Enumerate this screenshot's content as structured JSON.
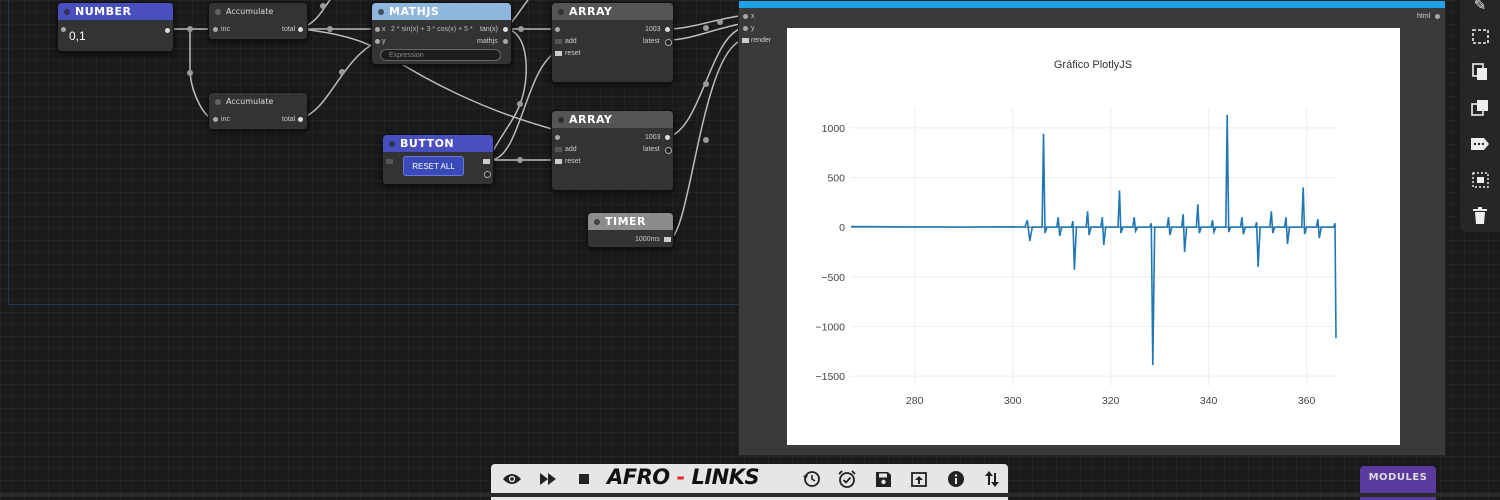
{
  "nodes": {
    "number": {
      "title": "NUMBER",
      "value": "0,1"
    },
    "accumulate1": {
      "title": "Accumulate",
      "in_label": "inc",
      "out_label": "total"
    },
    "accumulate2": {
      "title": "Accumulate",
      "in_label": "inc",
      "out_label": "total"
    },
    "mathjs": {
      "title": "MATHJS",
      "in_x": "x",
      "in_y": "y",
      "formula": "2 * sin(x) + 3 * cos(x) + 5 *",
      "out1": "tan(x)",
      "out2": "mathjs",
      "expr_placeholder": "Expression"
    },
    "array1": {
      "title": "ARRAY",
      "count": "1003",
      "add": "add",
      "reset": "reset",
      "latest": "latest"
    },
    "array2": {
      "title": "ARRAY",
      "count": "1003",
      "add": "add",
      "reset": "reset",
      "latest": "latest"
    },
    "button": {
      "title": "BUTTON",
      "label": "RESET ALL"
    },
    "timer": {
      "title": "TIMER",
      "interval": "1000ms"
    },
    "plotly": {
      "in_x": "x",
      "in_y": "y",
      "in_render": "render",
      "out": "html"
    }
  },
  "chart_data": {
    "type": "line",
    "title": "Gráfico PlotlyJS",
    "xlabel": "",
    "ylabel": "",
    "xlim": [
      267,
      366
    ],
    "ylim": [
      -1600,
      1200
    ],
    "xticks": [
      "280",
      "300",
      "320",
      "340",
      "360"
    ],
    "xtick_values": [
      280,
      300,
      320,
      340,
      360
    ],
    "yticks": [
      "1000",
      "500",
      "0",
      "−500",
      "−1000",
      "−1500"
    ],
    "ytick_values": [
      1000,
      500,
      0,
      -500,
      -1000,
      -1500
    ],
    "grid": true,
    "color": "#1f77b4",
    "series": [
      {
        "x": [
          267,
          280,
          290,
          300,
          302.5,
          303,
          303.5,
          304,
          306,
          306.3,
          306.6,
          307,
          309,
          309.3,
          309.6,
          310,
          312,
          312.3,
          312.6,
          313,
          315,
          315.3,
          315.6,
          316,
          318,
          318.3,
          318.6,
          319,
          321.5,
          321.8,
          322.1,
          322.5,
          324.5,
          324.8,
          325.1,
          325.5,
          328,
          328.3,
          328.6,
          329,
          331.5,
          331.8,
          332.1,
          332.5,
          334.5,
          334.8,
          335.1,
          335.5,
          337.5,
          337.8,
          338.1,
          338.5,
          340.5,
          340.8,
          341.1,
          341.5,
          343.5,
          343.8,
          344.1,
          344.5,
          346.5,
          346.8,
          347.1,
          347.5,
          349.5,
          349.8,
          350.1,
          350.5,
          352.5,
          352.8,
          353.1,
          353.5,
          355.5,
          355.8,
          356.1,
          356.5,
          359,
          359.3,
          359.6,
          360,
          362,
          362.3,
          362.6,
          363,
          365.5,
          365.8,
          366
        ],
        "y": [
          5,
          2,
          0,
          3,
          0,
          70,
          -140,
          0,
          0,
          940,
          -60,
          0,
          0,
          100,
          -90,
          0,
          0,
          60,
          -430,
          0,
          0,
          160,
          -80,
          0,
          0,
          100,
          -180,
          0,
          0,
          370,
          -60,
          0,
          0,
          100,
          -40,
          0,
          0,
          40,
          -1390,
          0,
          0,
          100,
          -80,
          0,
          0,
          130,
          -250,
          0,
          0,
          230,
          -60,
          0,
          0,
          70,
          -50,
          0,
          0,
          1130,
          -50,
          0,
          0,
          100,
          -70,
          0,
          0,
          50,
          -400,
          0,
          0,
          160,
          -60,
          0,
          0,
          100,
          -170,
          0,
          0,
          400,
          -70,
          0,
          0,
          80,
          -110,
          0,
          0,
          40,
          -1120
        ]
      }
    ]
  },
  "toolbar_right": {
    "icons": [
      "pencil-icon",
      "select-icon",
      "copy-icon",
      "clone-icon",
      "label-icon",
      "group-icon",
      "trash-icon"
    ]
  },
  "bottom_bar": {
    "logo_left": "AFRO",
    "logo_dash": "-",
    "logo_right": "LINKS"
  },
  "modules": {
    "label": "MODULES"
  }
}
